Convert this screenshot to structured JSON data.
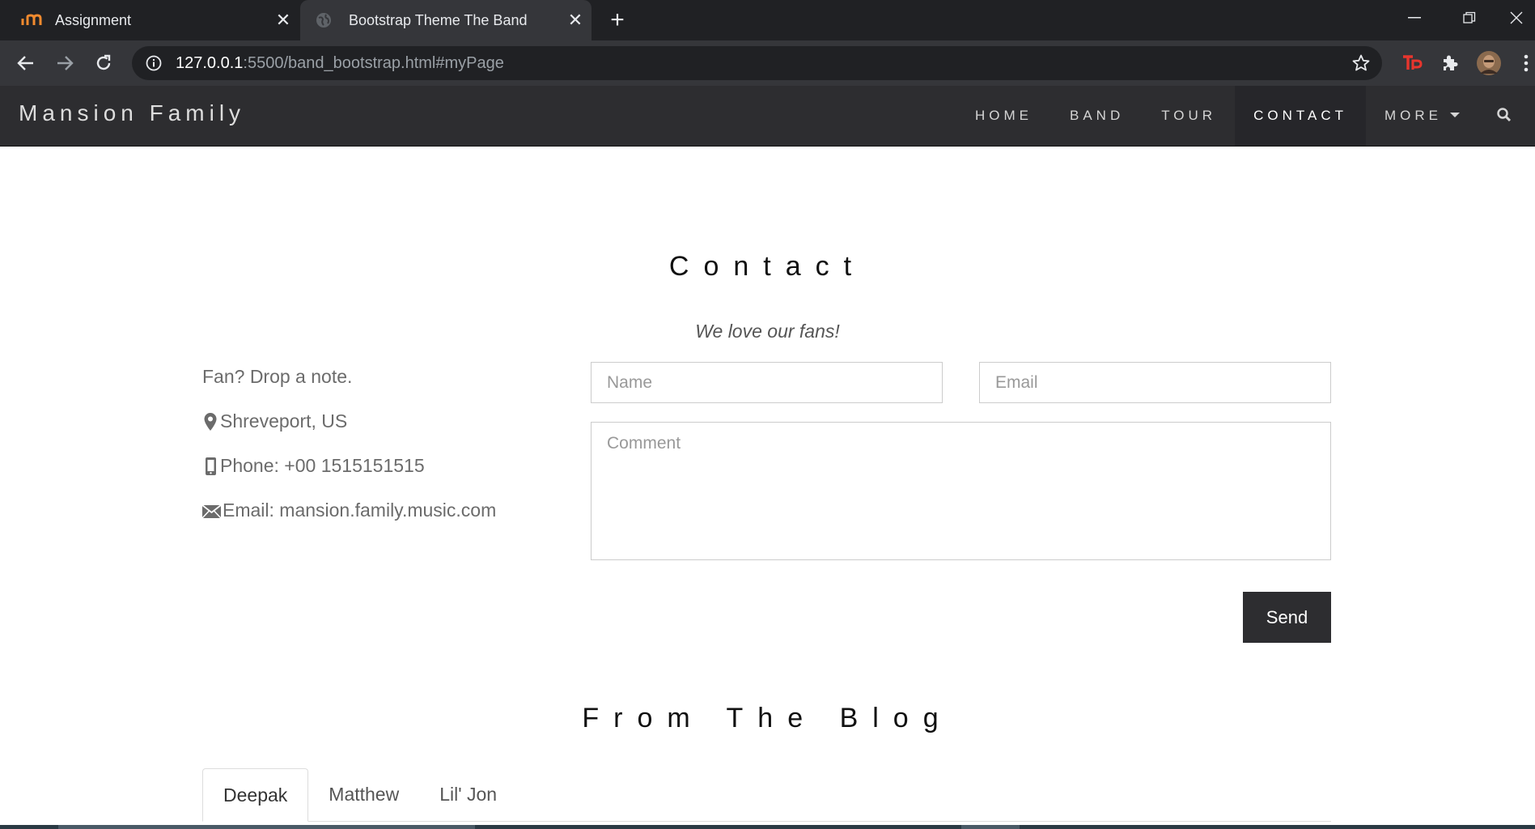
{
  "browser": {
    "tabs": [
      {
        "title": "Assignment",
        "active": false
      },
      {
        "title": "Bootstrap Theme The Band",
        "active": true
      }
    ],
    "url": {
      "host": "127.0.0.1",
      "path": ":5500/band_bootstrap.html#myPage"
    }
  },
  "navbar": {
    "brand": "Mansion Family",
    "links": [
      "HOME",
      "BAND",
      "TOUR",
      "CONTACT",
      "MORE"
    ],
    "active_link": "CONTACT"
  },
  "contact": {
    "title": "Contact",
    "tagline": "We love our fans!",
    "intro": "Fan? Drop a note.",
    "location": "Shreveport, US",
    "phone": "Phone: +00 1515151515",
    "email": "Email: mansion.family.music.com",
    "form": {
      "name_placeholder": "Name",
      "email_placeholder": "Email",
      "comment_placeholder": "Comment",
      "send_label": "Send"
    }
  },
  "blog": {
    "title": "From The Blog",
    "tabs": [
      "Deepak",
      "Matthew",
      "Lil' Jon"
    ],
    "active_tab": "Deepak"
  }
}
